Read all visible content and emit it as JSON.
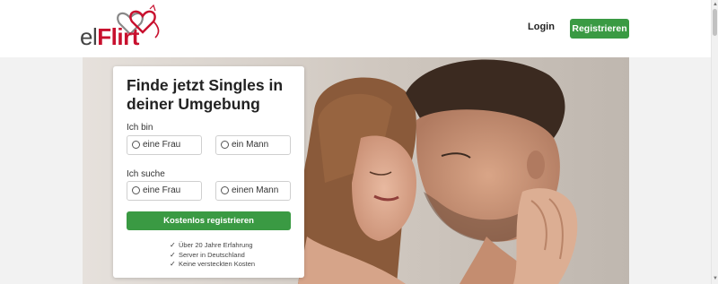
{
  "header": {
    "logo": {
      "part1": "el",
      "part2": "Flirt"
    },
    "login_label": "Login",
    "register_label": "Registrieren"
  },
  "form": {
    "title": "Finde jetzt Singles in deiner Umgebung",
    "i_am_label": "Ich bin",
    "i_am_options": [
      "eine Frau",
      "ein Mann"
    ],
    "seeking_label": "Ich suche",
    "seeking_options": [
      "eine Frau",
      "einen Mann"
    ],
    "submit_label": "Kostenlos registrieren",
    "benefits": [
      "Über 20 Jahre Erfahrung",
      "Server in Deutschland",
      "Keine versteckten Kosten"
    ]
  },
  "colors": {
    "accent_green": "#3a9a43",
    "brand_red": "#c8102e",
    "logo_gray": "#444444"
  },
  "icons": [
    "hearts-logo-icon",
    "check-icon",
    "radio-icon"
  ]
}
